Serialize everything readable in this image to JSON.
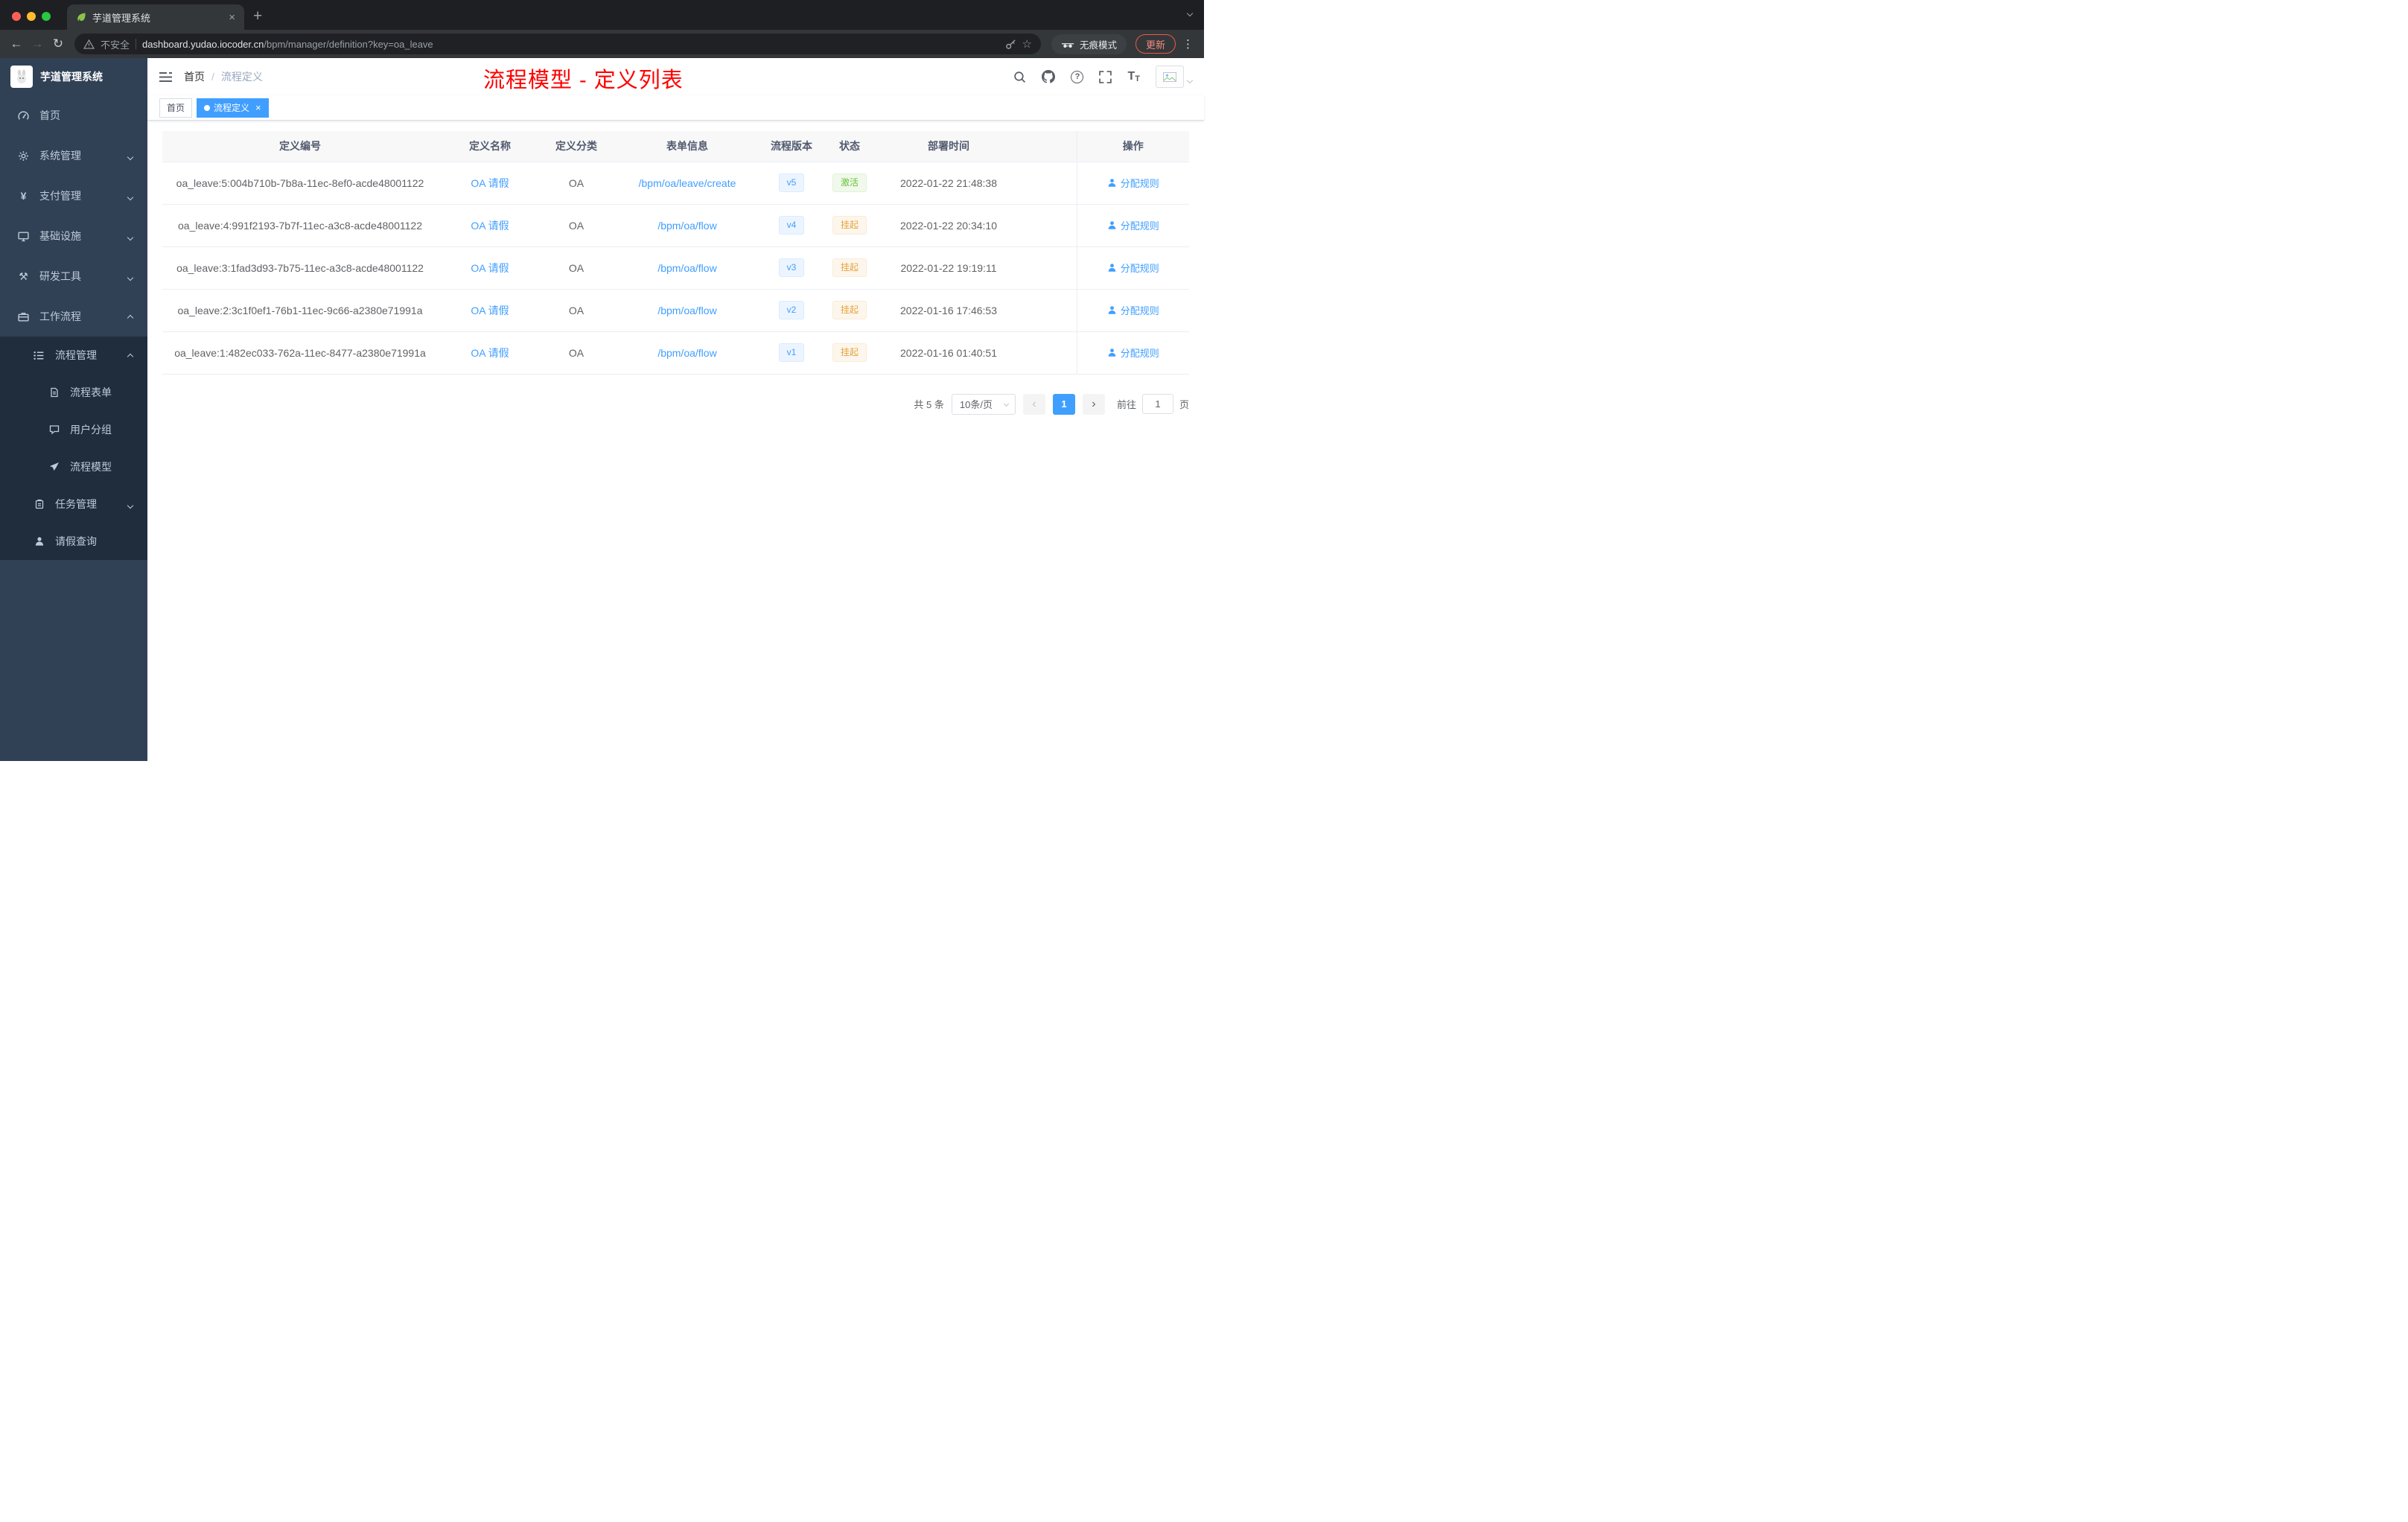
{
  "browser": {
    "tab_title": "芋道管理系统",
    "not_secure": "不安全",
    "url_host": "dashboard.yudao.iocoder.cn",
    "url_path": "/bpm/manager/definition?key=oa_leave",
    "incognito": "无痕模式",
    "update": "更新"
  },
  "icons": {
    "close": "×",
    "plus": "+",
    "kebab": "⋮",
    "back": "←",
    "forward": "→",
    "reload": "↻",
    "star": "☆",
    "prev": "‹",
    "next": "›",
    "yen": "¥",
    "tools": "⚒",
    "question": "?",
    "font_size": "T"
  },
  "colors": {
    "accent": "#409eff",
    "annotation_red": "#ff0000",
    "sidebar_bg": "#304156",
    "status_active_green": "#67c23a",
    "status_suspend_orange": "#e6a23c"
  },
  "sidebar": {
    "logo_title": "芋道管理系统",
    "menu": [
      {
        "label": "首页"
      },
      {
        "label": "系统管理"
      },
      {
        "label": "支付管理"
      },
      {
        "label": "基础设施"
      },
      {
        "label": "研发工具"
      },
      {
        "label": "工作流程"
      },
      {
        "label": "流程管理"
      },
      {
        "label": "流程表单"
      },
      {
        "label": "用户分组"
      },
      {
        "label": "流程模型"
      },
      {
        "label": "任务管理"
      },
      {
        "label": "请假查询"
      }
    ]
  },
  "header": {
    "breadcrumb": [
      "首页",
      "流程定义"
    ],
    "title": "流程模型 - 定义列表"
  },
  "tags": {
    "items": [
      {
        "label": "首页",
        "active": false
      },
      {
        "label": "流程定义",
        "active": true
      }
    ]
  },
  "table": {
    "headers": [
      "定义编号",
      "定义名称",
      "定义分类",
      "表单信息",
      "流程版本",
      "状态",
      "部署时间",
      "操作"
    ],
    "rows": [
      {
        "id": "oa_leave:5:004b710b-7b8a-11ec-8ef0-acde48001122",
        "name": "OA 请假",
        "category": "OA",
        "form": "/bpm/oa/leave/create",
        "version": "v5",
        "status": "激活",
        "time": "2022-01-22 21:48:38",
        "action": "分配规则"
      },
      {
        "id": "oa_leave:4:991f2193-7b7f-11ec-a3c8-acde48001122",
        "name": "OA 请假",
        "category": "OA",
        "form": "/bpm/oa/flow",
        "version": "v4",
        "status": "挂起",
        "time": "2022-01-22 20:34:10",
        "action": "分配规则"
      },
      {
        "id": "oa_leave:3:1fad3d93-7b75-11ec-a3c8-acde48001122",
        "name": "OA 请假",
        "category": "OA",
        "form": "/bpm/oa/flow",
        "version": "v3",
        "status": "挂起",
        "time": "2022-01-22 19:19:11",
        "action": "分配规则"
      },
      {
        "id": "oa_leave:2:3c1f0ef1-76b1-11ec-9c66-a2380e71991a",
        "name": "OA 请假",
        "category": "OA",
        "form": "/bpm/oa/flow",
        "version": "v2",
        "status": "挂起",
        "time": "2022-01-16 17:46:53",
        "action": "分配规则"
      },
      {
        "id": "oa_leave:1:482ec033-762a-11ec-8477-a2380e71991a",
        "name": "OA 请假",
        "category": "OA",
        "form": "/bpm/oa/flow",
        "version": "v1",
        "status": "挂起",
        "time": "2022-01-16 01:40:51",
        "action": "分配规则"
      }
    ]
  },
  "pagination": {
    "total": "共 5 条",
    "page_size": "10条/页",
    "current_page": "1",
    "goto_label": "前往",
    "goto_value": "1",
    "page_unit": "页"
  }
}
